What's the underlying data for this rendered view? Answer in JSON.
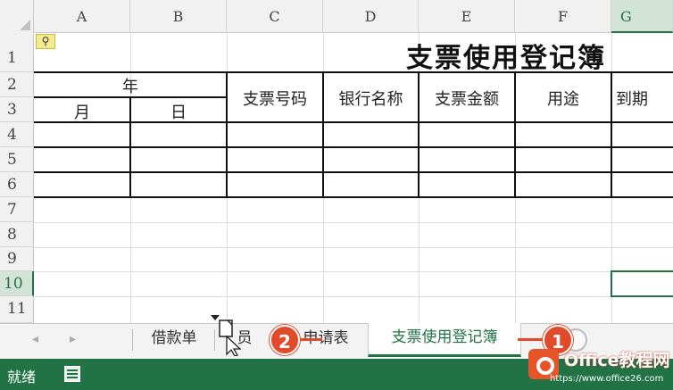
{
  "columns": [
    "A",
    "B",
    "C",
    "D",
    "E",
    "F",
    "G"
  ],
  "selected_column": "G",
  "rows": [
    "1",
    "2",
    "3",
    "4",
    "5",
    "6",
    "7",
    "8",
    "9",
    "10",
    "11"
  ],
  "selected_row": "10",
  "table": {
    "title": "支票使用登记簿",
    "year_label": "年",
    "month_label": "月",
    "day_label": "日",
    "col_check_no": "支票号码",
    "col_bank": "银行名称",
    "col_amount": "支票金额",
    "col_purpose": "用途",
    "col_due": "到期"
  },
  "tabs": {
    "prev_arrow": "◂",
    "next_arrow": "▸",
    "tab1": "借款单",
    "tab2_left": "员",
    "tab2_right": "申请表",
    "tab3": "支票使用登记簿",
    "badge1": "1",
    "badge2": "2"
  },
  "status": {
    "ready": "就绪"
  },
  "watermark": {
    "brand": "Office教程网",
    "url": "https://www.office26.com"
  },
  "colors": {
    "accent": "#217346",
    "badge": "#e14b2b"
  }
}
